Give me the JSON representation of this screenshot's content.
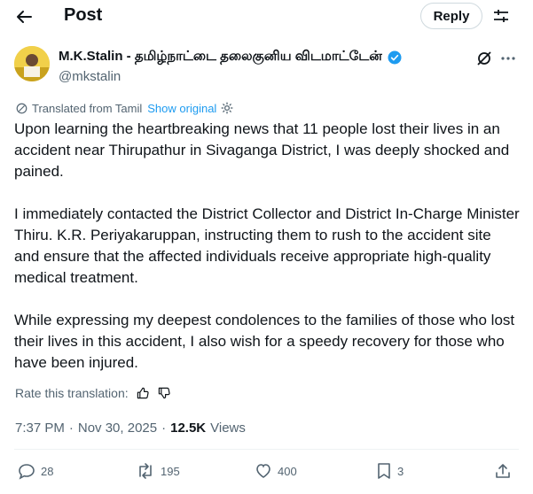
{
  "header": {
    "title": "Post",
    "reply_label": "Reply"
  },
  "author": {
    "name": "M.K.Stalin - தமிழ்நாட்டை தலைகுனிய விடமாட்டேன்",
    "handle": "@mkstalin",
    "verified_color": "#1d9bf0"
  },
  "translation": {
    "label": "Translated from Tamil",
    "show_original": "Show original"
  },
  "post": {
    "paragraphs": [
      "Upon learning the heartbreaking news that 11 people lost their lives in an accident near Thirupathur in Sivaganga District, I was deeply shocked and pained.",
      "I immediately contacted the District Collector and District In-Charge Minister Thiru. K.R. Periyakaruppan, instructing them to rush to the accident site and ensure that the affected individuals receive appropriate high-quality medical treatment.",
      "While expressing my deepest condolences to the families of those who lost their lives in this accident, I also wish for a speedy recovery for those who have been injured."
    ]
  },
  "rate": {
    "label": "Rate this translation:"
  },
  "meta": {
    "time": "7:37 PM",
    "sep": "·",
    "date": "Nov 30, 2025",
    "views_count": "12.5K",
    "views_label": "Views"
  },
  "actions": {
    "replies": "28",
    "reposts": "195",
    "likes": "400",
    "bookmarks": "3"
  },
  "icons": [
    "back-arrow-icon",
    "settings-icon",
    "verified-badge-icon",
    "grok-icon",
    "more-icon",
    "translate-icon",
    "gear-icon",
    "thumbs-up-icon",
    "thumbs-down-icon",
    "reply-icon",
    "repost-icon",
    "like-icon",
    "bookmark-icon",
    "share-icon"
  ]
}
